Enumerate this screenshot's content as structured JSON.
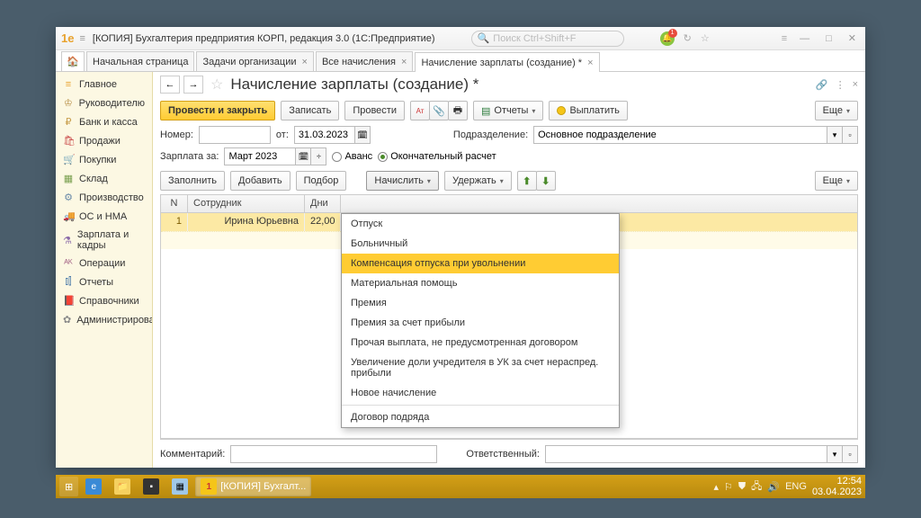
{
  "titlebar": {
    "logo": "1e",
    "app_title": "[КОПИЯ] Бухгалтерия предприятия КОРП, редакция 3.0  (1С:Предприятие)",
    "search_placeholder": "Поиск Ctrl+Shift+F",
    "bell_badge": "1"
  },
  "tabs": {
    "items": [
      {
        "label": "Начальная страница"
      },
      {
        "label": "Задачи организации"
      },
      {
        "label": "Все начисления"
      },
      {
        "label": "Начисление зарплаты (создание) *"
      }
    ]
  },
  "sidebar": {
    "items": [
      {
        "icon": "≡",
        "label": "Главное",
        "color": "#e8a22e"
      },
      {
        "icon": "♔",
        "label": "Руководителю",
        "color": "#b89048"
      },
      {
        "icon": "₽",
        "label": "Банк и касса",
        "color": "#c9a050"
      },
      {
        "icon": "🛍",
        "label": "Продажи",
        "color": "#c94848"
      },
      {
        "icon": "🛒",
        "label": "Покупки",
        "color": "#333"
      },
      {
        "icon": "▦",
        "label": "Склад",
        "color": "#7aa050"
      },
      {
        "icon": "⚙",
        "label": "Производство",
        "color": "#6a8aa8"
      },
      {
        "icon": "🚚",
        "label": "ОС и НМА",
        "color": "#5a7898"
      },
      {
        "icon": "⚗",
        "label": "Зарплата и кадры",
        "color": "#8a6aa8"
      },
      {
        "icon": "ᴬᴷ",
        "label": "Операции",
        "color": "#a86a8a"
      },
      {
        "icon": "⫾⫿",
        "label": "Отчеты",
        "color": "#4878a8"
      },
      {
        "icon": "📕",
        "label": "Справочники",
        "color": "#c87838"
      },
      {
        "icon": "✿",
        "label": "Администрирование",
        "color": "#888"
      }
    ]
  },
  "page": {
    "title": "Начисление зарплаты (создание) *",
    "primary_btn": "Провести и закрыть",
    "write_btn": "Записать",
    "post_btn": "Провести",
    "reports_btn": "Отчеты",
    "pay_btn": "Выплатить",
    "more_btn": "Еще",
    "number_label": "Номер:",
    "from_label": "от:",
    "date_value": "31.03.2023",
    "dept_label": "Подразделение:",
    "dept_value": "Основное подразделение",
    "salary_for_label": "Зарплата за:",
    "period_value": "Март 2023",
    "advance_label": "Аванс",
    "final_label": "Окончательный расчет",
    "fill_btn": "Заполнить",
    "add_btn": "Добавить",
    "pick_btn": "Подбор",
    "accrue_btn": "Начислить",
    "deduct_btn": "Удержать",
    "more2_btn": "Еще",
    "comment_label": "Комментарий:",
    "responsible_label": "Ответственный:"
  },
  "table": {
    "headers": {
      "n": "N",
      "employee": "Сотрудник",
      "days": "Дни"
    },
    "rows": [
      {
        "n": "1",
        "employee": "Ирина Юрьевна",
        "days": "22,00"
      }
    ]
  },
  "dropdown": {
    "items": [
      "Отпуск",
      "Больничный",
      "Компенсация отпуска при увольнении",
      "Материальная помощь",
      "Премия",
      "Премия за счет прибыли",
      "Прочая выплата, не предусмотренная договором",
      "Увеличение доли учредителя в УК за счет нераспред. прибыли",
      "Новое начисление",
      "-",
      "Договор подряда"
    ],
    "hover_index": 2
  },
  "taskbar": {
    "active_label": "[КОПИЯ] Бухгалт...",
    "lang": "ENG",
    "time": "12:54",
    "date": "03.04.2023"
  }
}
